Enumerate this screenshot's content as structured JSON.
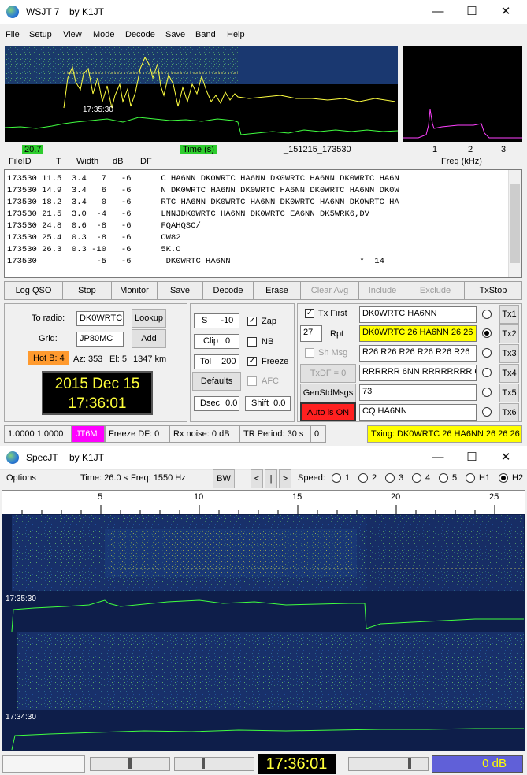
{
  "main_window": {
    "title": "WSJT 7",
    "by": "by K1JT",
    "menu": [
      "File",
      "Setup",
      "View",
      "Mode",
      "Decode",
      "Save",
      "Band",
      "Help"
    ],
    "spectrum_time_label": "17:35:30",
    "level_value": "20.7",
    "time_axis_label": "Time (s)",
    "file_name": "_151215_173530",
    "freq_ticks": [
      "1",
      "2",
      "3"
    ],
    "freq_axis_label": "Freq (kHz)",
    "columns": [
      "FileID",
      "T",
      "Width",
      "dB",
      "DF"
    ],
    "decodes": [
      "173530 11.5  3.4   7   -6      C HA6NN DK0WRTC HA6NN DK0WRTC HA6NN DK0WRTC HA6N",
      "173530 14.9  3.4   6   -6      N DK0WRTC HA6NN DK0WRTC HA6NN DK0WRTC HA6NN DK0W",
      "173530 18.2  3.4   0   -6      RTC HA6NN DK0WRTC HA6NN DK0WRTC HA6NN DK0WRTC HA",
      "173530 21.5  3.0  -4   -6      LNNJDK0WRTC HA6NN DK0WRTC EA6NN DK5WRK6,DV",
      "173530 24.8  0.6  -8   -6      FQAHQSC/",
      "173530 25.4  0.3  -8   -6      OW82",
      "173530 26.3  0.3 -10   -6      5K.O",
      "173530            -5   -6       DK0WRTC HA6NN                          *  14"
    ],
    "buttons": [
      "Log QSO",
      "Stop",
      "Monitor",
      "Save",
      "Decode",
      "Erase",
      "Clear Avg",
      "Include",
      "Exclude",
      "TxStop"
    ],
    "to_radio_label": "To radio:",
    "to_radio_value": "DK0WRTC",
    "grid_label": "Grid:",
    "grid_value": "JP80MC",
    "lookup": "Lookup",
    "add": "Add",
    "hotb": "Hot B: 4",
    "az": "Az: 353",
    "el": "El: 5",
    "dist": "1347 km",
    "date": "2015 Dec 15",
    "time": "17:36:01",
    "s_label": "S",
    "s_value": "-10",
    "clip_label": "Clip",
    "clip_value": "0",
    "tol_label": "Tol",
    "tol_value": "200",
    "defaults": "Defaults",
    "dsec_label": "Dsec",
    "dsec_value": "0.0",
    "shift_label": "Shift",
    "shift_value": "0.0",
    "zap": "Zap",
    "nb": "NB",
    "freeze": "Freeze",
    "afc": "AFC",
    "tx_first": "Tx First",
    "rpt_value": "27",
    "rpt": "Rpt",
    "sh_msg": "Sh Msg",
    "txdf": "TxDF = 0",
    "genstd": "GenStdMsgs",
    "auto": "Auto is ON",
    "tx_msgs": [
      "DK0WRTC HA6NN",
      "DK0WRTC 26 HA6NN 26 26 26",
      "R26 R26 R26 R26 R26 R26",
      "RRRRRR 6NN RRRRRRRR 6NN",
      "73",
      "CQ HA6NN"
    ],
    "tx_labels": [
      "Tx1",
      "Tx2",
      "Tx3",
      "Tx4",
      "Tx5",
      "Tx6"
    ],
    "status": {
      "levels": "1.0000 1.0000",
      "mode": "JT6M",
      "freeze_df": "Freeze DF:  0",
      "rx_noise": "Rx noise:  0 dB",
      "tr_period": "TR Period: 30 s",
      "zero": "0",
      "txing": "Txing:  DK0WRTC 26 HA6NN 26 26 26"
    }
  },
  "spec_window": {
    "title": "SpecJT",
    "by": "by K1JT",
    "options": "Options",
    "time": "Time: 26.0 s",
    "freq": "Freq: 1550 Hz",
    "bw": "BW",
    "nav": [
      "<",
      "|",
      ">"
    ],
    "speed_label": "Speed:",
    "speeds": [
      "1",
      "2",
      "3",
      "4",
      "5",
      "H1",
      "H2"
    ],
    "ticks": [
      "5",
      "10",
      "15",
      "20",
      "25"
    ],
    "time1": "17:35:30",
    "time2": "17:34:30",
    "clock": "17:36:01",
    "db": "0 dB"
  },
  "colors": {
    "green": "#2ecc2e",
    "yellow": "#ffff00",
    "red": "#ff2020",
    "magenta": "#ff00ff",
    "orange": "#ff9a2e"
  }
}
